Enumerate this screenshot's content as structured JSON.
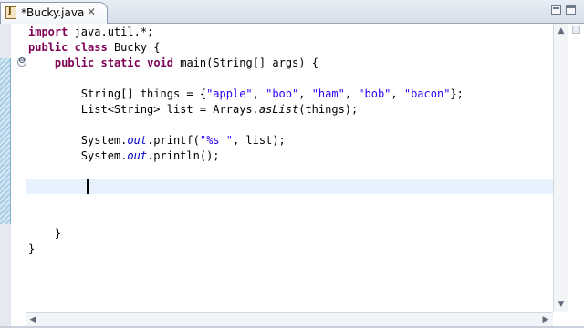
{
  "tab": {
    "label": "*Bucky.java",
    "file_icon": "java-file-icon",
    "close_glyph": "✕"
  },
  "window": {
    "minimize_icon": "minimize-icon",
    "maximize_icon": "maximize-icon"
  },
  "editor": {
    "fold_glyph": "⊖",
    "current_line_color": "#e8f2fe",
    "code_lines": [
      {
        "tokens": [
          {
            "t": "import",
            "c": "kw"
          },
          {
            "t": " java.util.*;"
          }
        ]
      },
      {
        "tokens": [
          {
            "t": "public",
            "c": "kw"
          },
          {
            "t": " "
          },
          {
            "t": "class",
            "c": "kw"
          },
          {
            "t": " Bucky {"
          }
        ]
      },
      {
        "tokens": [
          {
            "t": "    "
          },
          {
            "t": "public",
            "c": "kw"
          },
          {
            "t": " "
          },
          {
            "t": "static",
            "c": "kw"
          },
          {
            "t": " "
          },
          {
            "t": "void",
            "c": "kw"
          },
          {
            "t": " main(String[] args) {"
          }
        ]
      },
      {
        "tokens": []
      },
      {
        "tokens": [
          {
            "t": "        String[] things = {"
          },
          {
            "t": "\"apple\"",
            "c": "str"
          },
          {
            "t": ", "
          },
          {
            "t": "\"bob\"",
            "c": "str"
          },
          {
            "t": ", "
          },
          {
            "t": "\"ham\"",
            "c": "str"
          },
          {
            "t": ", "
          },
          {
            "t": "\"bob\"",
            "c": "str"
          },
          {
            "t": ", "
          },
          {
            "t": "\"bacon\"",
            "c": "str"
          },
          {
            "t": "};"
          }
        ]
      },
      {
        "tokens": [
          {
            "t": "        List<String> list = Arrays."
          },
          {
            "t": "asList",
            "c": "it"
          },
          {
            "t": "(things);"
          }
        ]
      },
      {
        "tokens": []
      },
      {
        "tokens": [
          {
            "t": "        System."
          },
          {
            "t": "out",
            "c": "fld"
          },
          {
            "t": ".printf("
          },
          {
            "t": "\"%s \"",
            "c": "str"
          },
          {
            "t": ", list);"
          }
        ]
      },
      {
        "tokens": [
          {
            "t": "        System."
          },
          {
            "t": "out",
            "c": "fld"
          },
          {
            "t": ".println();"
          }
        ]
      },
      {
        "tokens": []
      },
      {
        "tokens": []
      },
      {
        "tokens": []
      },
      {
        "tokens": []
      },
      {
        "tokens": [
          {
            "t": "    }"
          }
        ]
      },
      {
        "tokens": [
          {
            "t": "}"
          }
        ]
      }
    ]
  },
  "scrollbars": {
    "up_glyph": "▲",
    "down_glyph": "▼",
    "left_glyph": "◀",
    "right_glyph": "▶"
  }
}
